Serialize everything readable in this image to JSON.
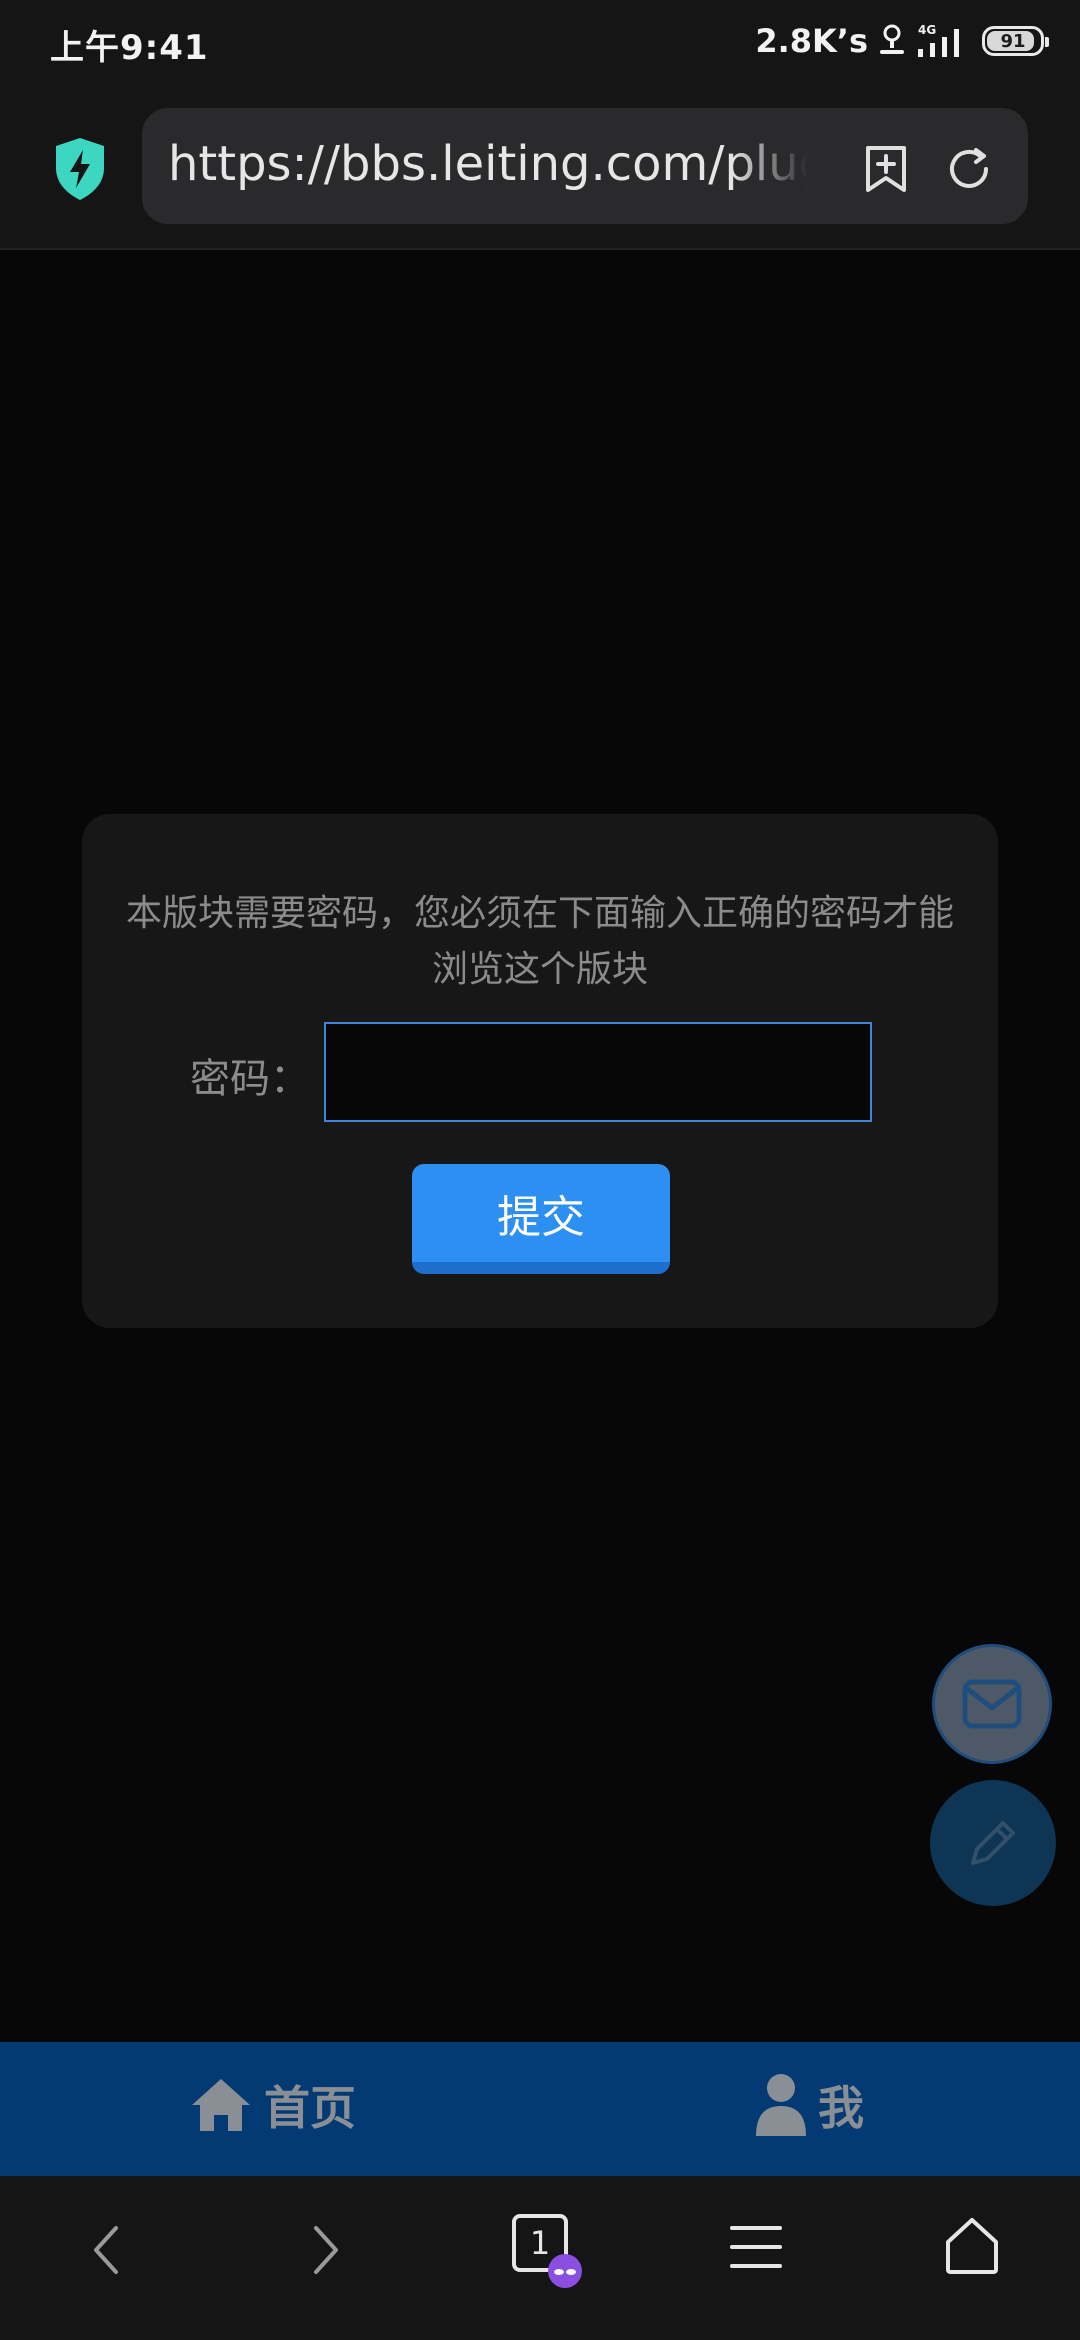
{
  "status_bar": {
    "time": "上午9:41",
    "net_speed": "2.8K’s",
    "network_type": "4G",
    "battery": 91
  },
  "browser": {
    "url": "https://bbs.leiting.com/plugin.php",
    "tab_count": "1"
  },
  "card": {
    "message": "本版块需要密码，您必须在下面输入正确的密码才能浏览这个版块",
    "password_label": "密码：",
    "password_value": "",
    "submit_label": "提交"
  },
  "site_nav": {
    "home_label": "首页",
    "me_label": "我"
  },
  "colors": {
    "accent": "#2d8ff2",
    "nav_bg": "#033a73",
    "shield": "#3dd6c0",
    "incognito": "#8a4fe0"
  },
  "icons": {
    "shield": "shield-bolt-icon",
    "bookmark": "bookmark-add-icon",
    "reload": "reload-icon",
    "mail": "mail-icon",
    "edit": "pencil-icon",
    "home": "home-icon",
    "user": "user-icon",
    "back": "chevron-left-icon",
    "forward": "chevron-right-icon",
    "menu": "menu-icon",
    "browser_home": "house-icon"
  }
}
